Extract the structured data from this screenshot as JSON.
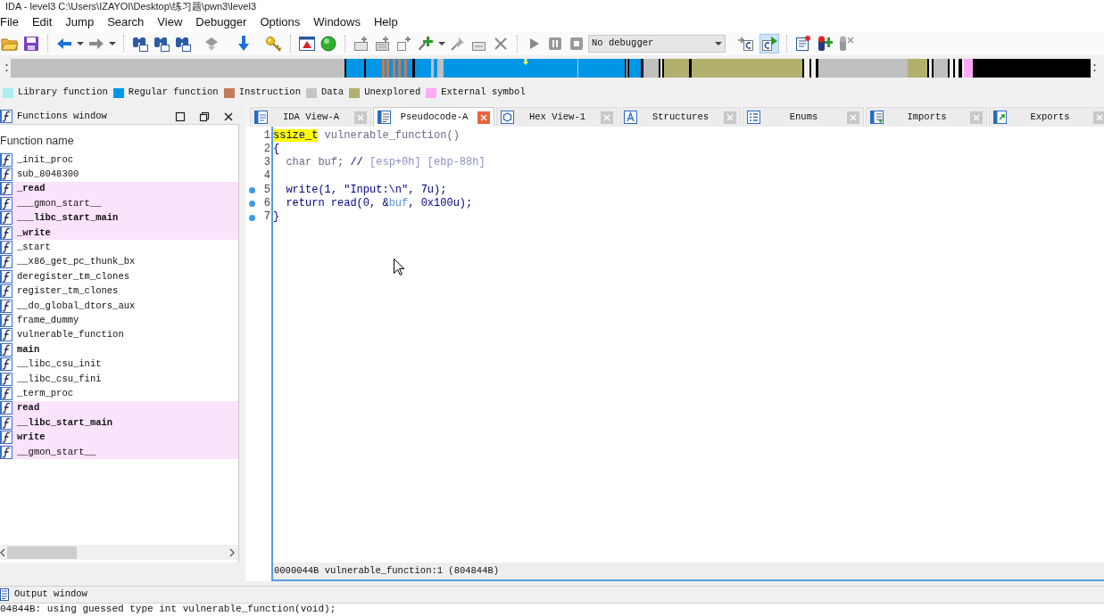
{
  "window": {
    "title": "IDA - level3 C:\\Users\\IZAYOI\\Desktop\\练习题\\pwn3\\level3"
  },
  "menu": [
    "File",
    "Edit",
    "Jump",
    "Search",
    "View",
    "Debugger",
    "Options",
    "Windows",
    "Help"
  ],
  "toolbar": {
    "debugger": "No debugger",
    "sync_buttons": [
      {
        "selected": false
      },
      {
        "selected": true
      }
    ]
  },
  "legend": [
    {
      "label": "Library function",
      "color": "#a8f0f0"
    },
    {
      "label": "Regular function",
      "color": "#0096e8"
    },
    {
      "label": "Instruction",
      "color": "#c47c58"
    },
    {
      "label": "Data",
      "color": "#c4c4c4"
    },
    {
      "label": "Unexplored",
      "color": "#b2b06e"
    },
    {
      "label": "External symbol",
      "color": "#ffaaf8"
    }
  ],
  "functions_window": {
    "title": "Functions window",
    "column": "Function name",
    "rows": [
      {
        "name": "_init_proc",
        "external": false,
        "bold": false
      },
      {
        "name": "sub_8048300",
        "external": false,
        "bold": false
      },
      {
        "name": "_read",
        "external": true,
        "bold": true
      },
      {
        "name": "___gmon_start__",
        "external": true,
        "bold": false
      },
      {
        "name": "___libc_start_main",
        "external": true,
        "bold": true
      },
      {
        "name": "_write",
        "external": true,
        "bold": true
      },
      {
        "name": "_start",
        "external": false,
        "bold": false
      },
      {
        "name": "__x86_get_pc_thunk_bx",
        "external": false,
        "bold": false
      },
      {
        "name": "deregister_tm_clones",
        "external": false,
        "bold": false
      },
      {
        "name": "register_tm_clones",
        "external": false,
        "bold": false
      },
      {
        "name": "__do_global_dtors_aux",
        "external": false,
        "bold": false
      },
      {
        "name": "frame_dummy",
        "external": false,
        "bold": false
      },
      {
        "name": "vulnerable_function",
        "external": false,
        "bold": false
      },
      {
        "name": "main",
        "external": false,
        "bold": true
      },
      {
        "name": "__libc_csu_init",
        "external": false,
        "bold": false
      },
      {
        "name": "__libc_csu_fini",
        "external": false,
        "bold": false
      },
      {
        "name": "_term_proc",
        "external": false,
        "bold": false
      },
      {
        "name": "read",
        "external": true,
        "bold": true
      },
      {
        "name": "__libc_start_main",
        "external": true,
        "bold": true
      },
      {
        "name": "write",
        "external": true,
        "bold": true
      },
      {
        "name": "__gmon_start__",
        "external": true,
        "bold": false
      }
    ]
  },
  "tabs": [
    {
      "label": "IDA View-A",
      "selected": false
    },
    {
      "label": "Pseudocode-A",
      "selected": true
    },
    {
      "label": "Hex View-1",
      "selected": false
    },
    {
      "label": "Structures",
      "selected": false
    },
    {
      "label": "Enums",
      "selected": false
    },
    {
      "label": "Imports",
      "selected": false
    },
    {
      "label": "Exports",
      "selected": false
    }
  ],
  "pseudocode": {
    "lines": [
      {
        "number": "1",
        "marker": false,
        "segments": [
          {
            "kind": "highlight",
            "text": "ssize_t"
          },
          {
            "kind": "name",
            "text": " vulnerable_function()"
          }
        ]
      },
      {
        "number": "2",
        "marker": false,
        "segments": [
          {
            "kind": "code",
            "text": "{"
          }
        ]
      },
      {
        "number": "3",
        "marker": false,
        "segments": [
          {
            "kind": "name",
            "text": "  char buf; "
          },
          {
            "kind": "code",
            "text": "// "
          },
          {
            "kind": "comment",
            "text": "[esp+0h] [ebp-88h]"
          }
        ]
      },
      {
        "number": "4",
        "marker": false
      },
      {
        "number": "5",
        "marker": true,
        "segments": [
          {
            "kind": "code",
            "text": "  write(1, \"Input:\\n\", 7u);"
          }
        ]
      },
      {
        "number": "6",
        "marker": true,
        "segments": [
          {
            "kind": "code",
            "text": "  return read(0, &"
          },
          {
            "kind": "var",
            "text": "buf"
          },
          {
            "kind": "code",
            "text": ", 0x100u);"
          }
        ]
      },
      {
        "number": "7",
        "marker": true,
        "segments": [
          {
            "kind": "code",
            "text": "}"
          }
        ]
      }
    ],
    "status": "0000044B vulnerable_function:1 (804844B)"
  },
  "output_window": {
    "title": "Output window",
    "lines": [
      "04844B: using guessed type int vulnerable_function(void);"
    ]
  }
}
